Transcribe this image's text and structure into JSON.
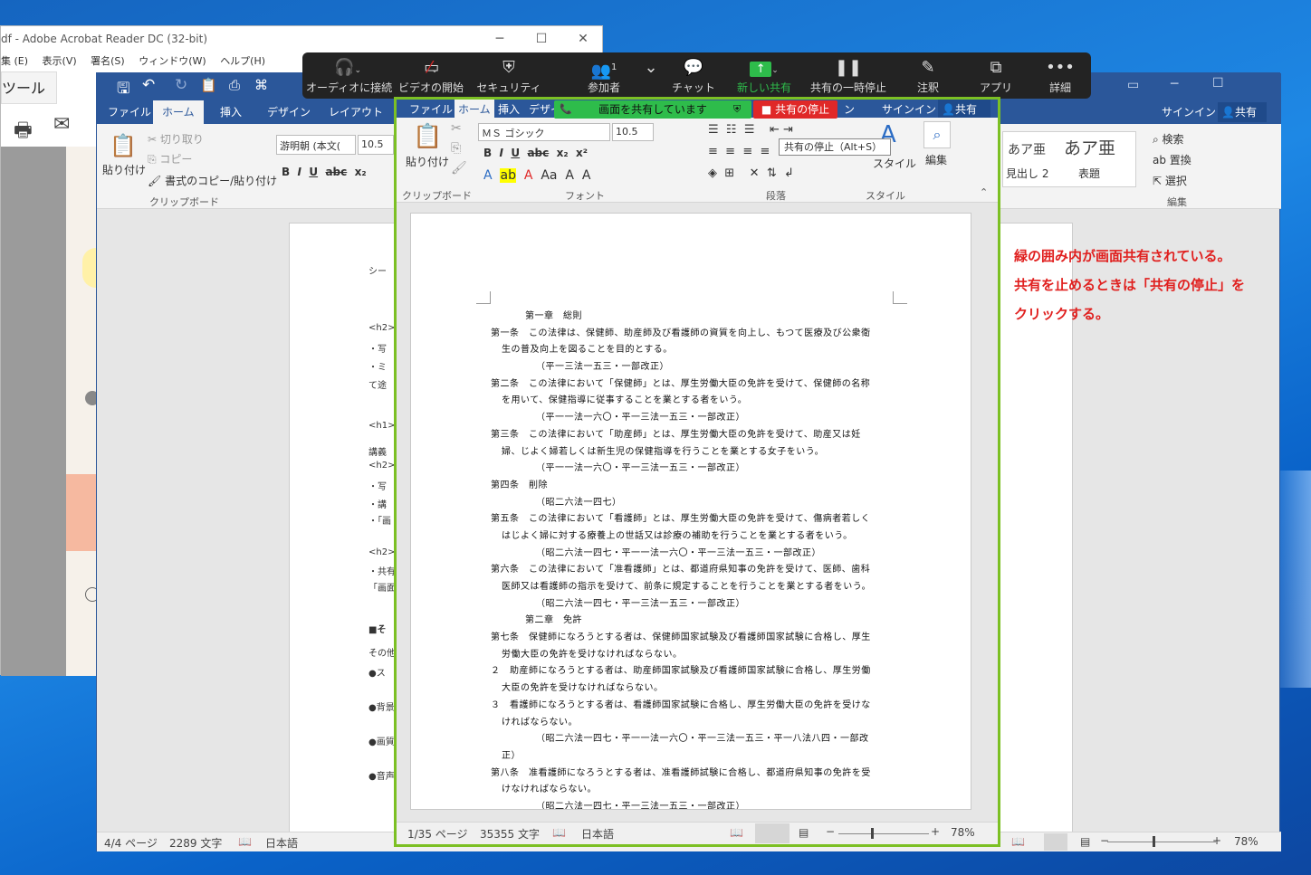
{
  "acrobat": {
    "title": "df - Adobe Acrobat Reader DC (32-bit)",
    "menu": [
      "集 (E)",
      "表示(V)",
      "署名(S)",
      "ウィンドウ(W)",
      "ヘルプ(H)"
    ],
    "tool_label": "ツール",
    "controls": {
      "minimize": "─",
      "maximize": "☐",
      "close": "✕"
    }
  },
  "word_back": {
    "tabs": [
      "ファイル",
      "ホーム",
      "挿入",
      "デザイン",
      "レイアウト"
    ],
    "title_right": {
      "signin": "サインイン",
      "share": "共有"
    },
    "ribbon": {
      "paste": "貼り付け",
      "cut": "切り取り",
      "copy": "コピー",
      "format_painter": "書式のコピー/貼り付け",
      "clipboard_group": "クリップボード",
      "font_name": "游明朝 (本文(",
      "font_size": "10.5",
      "search": "検索",
      "replace": "置換",
      "select": "選択",
      "edit_group": "編集",
      "style_heading2_sample": "あア亜",
      "style_heading2": "見出し 2",
      "style_title_sample": "あア亜",
      "style_title": "表題"
    },
    "page_fragments": [
      "シー",
      "<h2>",
      "・写",
      "・ミ",
      "て途",
      "<h1>",
      "講義",
      "<h2>",
      "・写",
      "・講",
      "・「画",
      "<h2>",
      "・共有",
      "「画面",
      "■そ",
      "その他",
      "●ス",
      "●背景",
      "●画質",
      "●音声"
    ],
    "status": {
      "page": "4/4 ページ",
      "words": "2289 文字",
      "lang": "日本語",
      "zoom": "78%"
    }
  },
  "zoom_toolbar": {
    "buttons": [
      {
        "icon": "headphones-icon",
        "label": "オーディオに接続"
      },
      {
        "icon": "video-off-icon",
        "label": "ビデオの開始"
      },
      {
        "icon": "shield-icon",
        "label": "セキュリティ"
      },
      {
        "icon": "participants-icon",
        "label": "参加者",
        "badge": "1"
      },
      {
        "icon": "chat-icon",
        "label": "チャット"
      },
      {
        "icon": "share-up-icon",
        "label": "新しい共有"
      },
      {
        "icon": "pause-icon",
        "label": "共有の一時停止"
      },
      {
        "icon": "pen-icon",
        "label": "注釈"
      },
      {
        "icon": "apps-icon",
        "label": "アプリ"
      },
      {
        "icon": "more-icon",
        "label": "詳細"
      }
    ],
    "colors": {
      "background": "#232323",
      "share_green": "#2ebc4b"
    }
  },
  "share_indicator": {
    "text": "画面を共有しています",
    "stop_label": "共有の停止",
    "tooltip": "共有の停止（Alt+S）",
    "colors": {
      "green": "#2ebc4b",
      "red": "#e02828",
      "frame": "#7cc024"
    }
  },
  "word_front": {
    "tabs": [
      "ファイル",
      "ホーム",
      "挿入",
      "デザイ",
      "ン",
      "サインイン",
      "共有"
    ],
    "ribbon": {
      "paste": "貼り付け",
      "clipboard_group": "クリップボード",
      "font_name": "ＭＳ ゴシック",
      "font_size": "10.5",
      "font_group": "フォント",
      "paragraph_group": "段落",
      "style_group": "スタイル",
      "style_label": "スタイル",
      "edit_label": "編集"
    },
    "document_lines": [
      "第一章　総則",
      "第一条　この法律は、保健師、助産師及び看護師の資質を向上し、もつて医療及び公衆衛",
      "生の普及向上を図ることを目的とする。",
      "（平一三法一五三・一部改正）",
      "第二条　この法律において「保健師」とは、厚生労働大臣の免許を受けて、保健師の名称",
      "を用いて、保健指導に従事することを業とする者をいう。",
      "（平一一法一六〇・平一三法一五三・一部改正）",
      "第三条　この法律において「助産師」とは、厚生労働大臣の免許を受けて、助産又は妊",
      "婦、じよく婦若しくは新生児の保健指導を行うことを業とする女子をいう。",
      "（平一一法一六〇・平一三法一五三・一部改正）",
      "第四条　削除",
      "（昭二六法一四七）",
      "第五条　この法律において「看護師」とは、厚生労働大臣の免許を受けて、傷病者若しく",
      "はじよく婦に対する療養上の世話又は診療の補助を行うことを業とする者をいう。",
      "（昭二六法一四七・平一一法一六〇・平一三法一五三・一部改正）",
      "第六条　この法律において「准看護師」とは、都道府県知事の免許を受けて、医師、歯科",
      "医師又は看護師の指示を受けて、前条に規定することを行うことを業とする者をいう。",
      "（昭二六法一四七・平一三法一五三・一部改正）",
      "第二章　免許",
      "第七条　保健師になろうとする者は、保健師国家試験及び看護師国家試験に合格し、厚生",
      "労働大臣の免許を受けなければならない。",
      "２　助産師になろうとする者は、助産師国家試験及び看護師国家試験に合格し、厚生労働",
      "大臣の免許を受けなければならない。",
      "３　看護師になろうとする者は、看護師国家試験に合格し、厚生労働大臣の免許を受けな",
      "ければならない。",
      "（昭二六法一四七・平一一法一六〇・平一三法一五三・平一八法八四・一部改",
      "正）",
      "第八条　准看護師になろうとする者は、准看護師試験に合格し、都道府県知事の免許を受",
      "けなければならない。",
      "（昭二六法一四七・平一三法一五三・一部改正）"
    ],
    "status": {
      "page": "1/35 ページ",
      "words": "35355 文字",
      "lang": "日本語",
      "zoom": "78%"
    }
  },
  "annotation": {
    "lines": [
      "緑の囲み内が画面共有されている。",
      "共有を止めるときは「共有の停止」を",
      "クリックする。"
    ],
    "color": "#e0201f"
  }
}
